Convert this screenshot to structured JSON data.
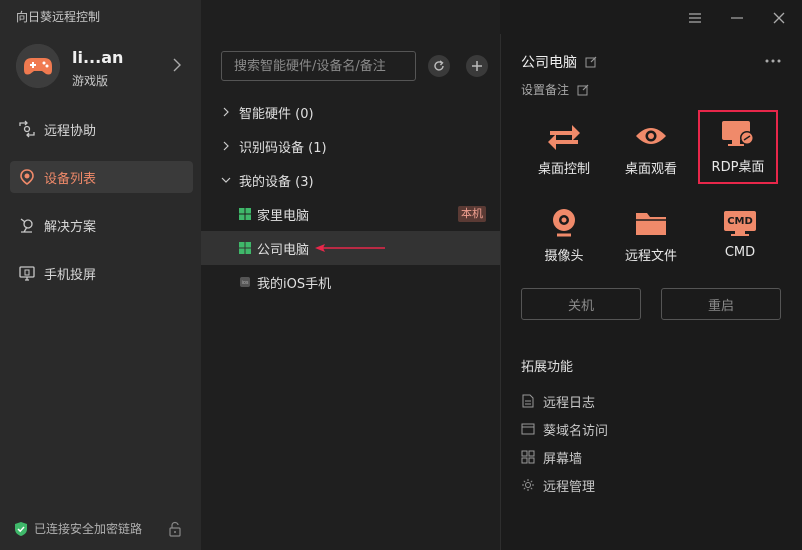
{
  "app": {
    "title": "向日葵远程控制"
  },
  "user": {
    "name": "li...an",
    "edition": "游戏版"
  },
  "nav": {
    "items": [
      {
        "label": "远程协助",
        "icon": "remote-assist-icon"
      },
      {
        "label": "设备列表",
        "icon": "device-list-icon",
        "active": true
      },
      {
        "label": "解决方案",
        "icon": "solution-icon"
      },
      {
        "label": "手机投屏",
        "icon": "phone-cast-icon"
      }
    ]
  },
  "status": {
    "security": "已连接安全加密链路"
  },
  "search": {
    "placeholder": "搜索智能硬件/设备名/备注"
  },
  "groups": [
    {
      "label": "智能硬件 (0)",
      "expanded": false
    },
    {
      "label": "识别码设备 (1)",
      "expanded": false
    },
    {
      "label": "我的设备 (3)",
      "expanded": true
    }
  ],
  "devices": [
    {
      "name": "家里电脑",
      "badge": "本机",
      "type": "windows"
    },
    {
      "name": "公司电脑",
      "type": "windows",
      "selected": true
    },
    {
      "name": "我的iOS手机",
      "type": "ios"
    }
  ],
  "detail": {
    "device_name": "公司电脑",
    "remark_label": "设置备注",
    "functions": [
      {
        "label": "桌面控制",
        "icon": "desktop-control-icon"
      },
      {
        "label": "桌面观看",
        "icon": "desktop-view-icon"
      },
      {
        "label": "RDP桌面",
        "icon": "rdp-desktop-icon",
        "highlighted": true
      },
      {
        "label": "摄像头",
        "icon": "camera-icon"
      },
      {
        "label": "远程文件",
        "icon": "remote-file-icon"
      },
      {
        "label": "CMD",
        "icon": "cmd-icon",
        "icon_text": "CMD"
      }
    ],
    "actions": {
      "shutdown": "关机",
      "restart": "重启"
    },
    "extensions_title": "拓展功能",
    "extensions": [
      {
        "label": "远程日志",
        "icon": "log-icon"
      },
      {
        "label": "葵域名访问",
        "icon": "domain-icon"
      },
      {
        "label": "屏幕墙",
        "icon": "screen-wall-icon"
      },
      {
        "label": "远程管理",
        "icon": "remote-manage-icon"
      }
    ]
  },
  "colors": {
    "accent": "#f08a6a",
    "highlight_border": "#e8274a",
    "arrow": "#e8274a"
  }
}
